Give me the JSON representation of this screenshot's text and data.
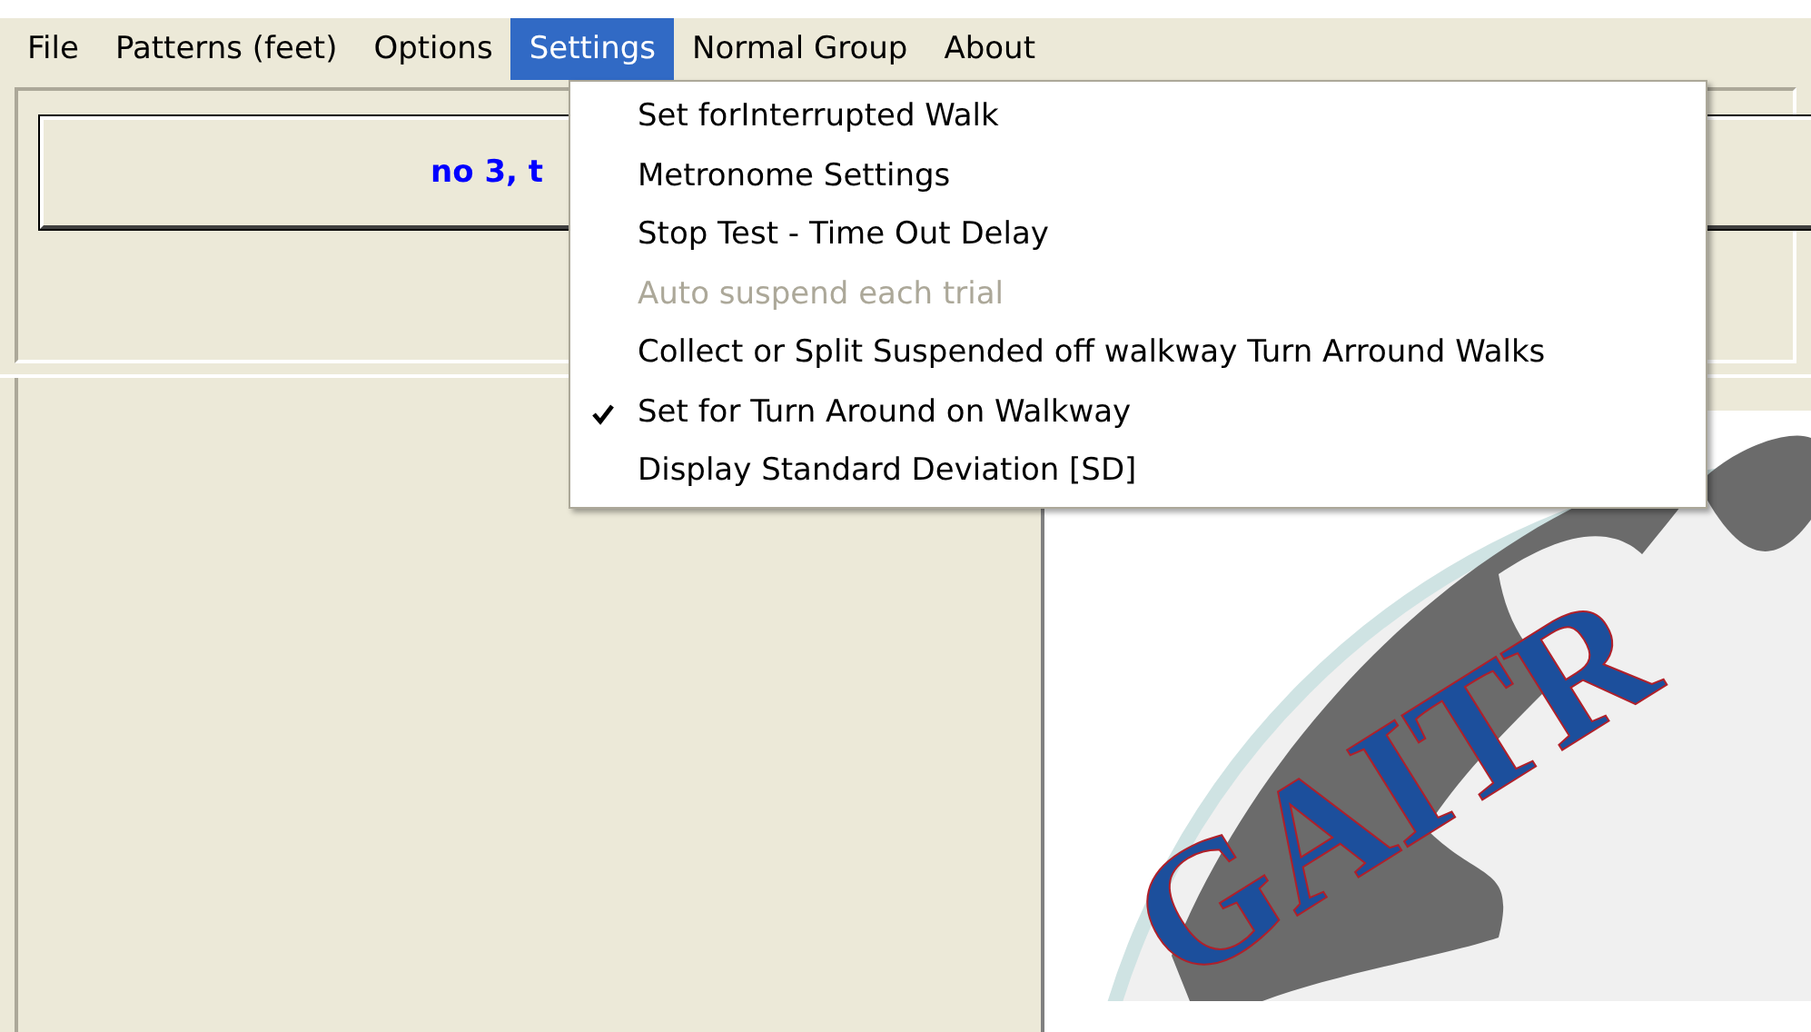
{
  "menubar": [
    {
      "label": "File",
      "selected": false
    },
    {
      "label": "Patterns (feet)",
      "selected": false
    },
    {
      "label": "Options",
      "selected": false
    },
    {
      "label": "Settings",
      "selected": true
    },
    {
      "label": "Normal Group",
      "selected": false
    },
    {
      "label": "About",
      "selected": false
    }
  ],
  "settings_menu": [
    {
      "label": "Set forInterrupted Walk",
      "checked": false,
      "disabled": false
    },
    {
      "label": "Metronome Settings",
      "checked": false,
      "disabled": false
    },
    {
      "label": "Stop Test - Time Out Delay",
      "checked": false,
      "disabled": false
    },
    {
      "label": "Auto suspend each trial",
      "checked": false,
      "disabled": true
    },
    {
      "label": "Collect or Split Suspended off walkway Turn Arround Walks",
      "checked": false,
      "disabled": false
    },
    {
      "label": "Set for Turn Around on Walkway",
      "checked": true,
      "disabled": false
    },
    {
      "label": "Display Standard Deviation [SD]",
      "checked": false,
      "disabled": false
    }
  ],
  "top_panel": {
    "button": "no 3, t"
  },
  "logo": {
    "text": "GAITR"
  }
}
